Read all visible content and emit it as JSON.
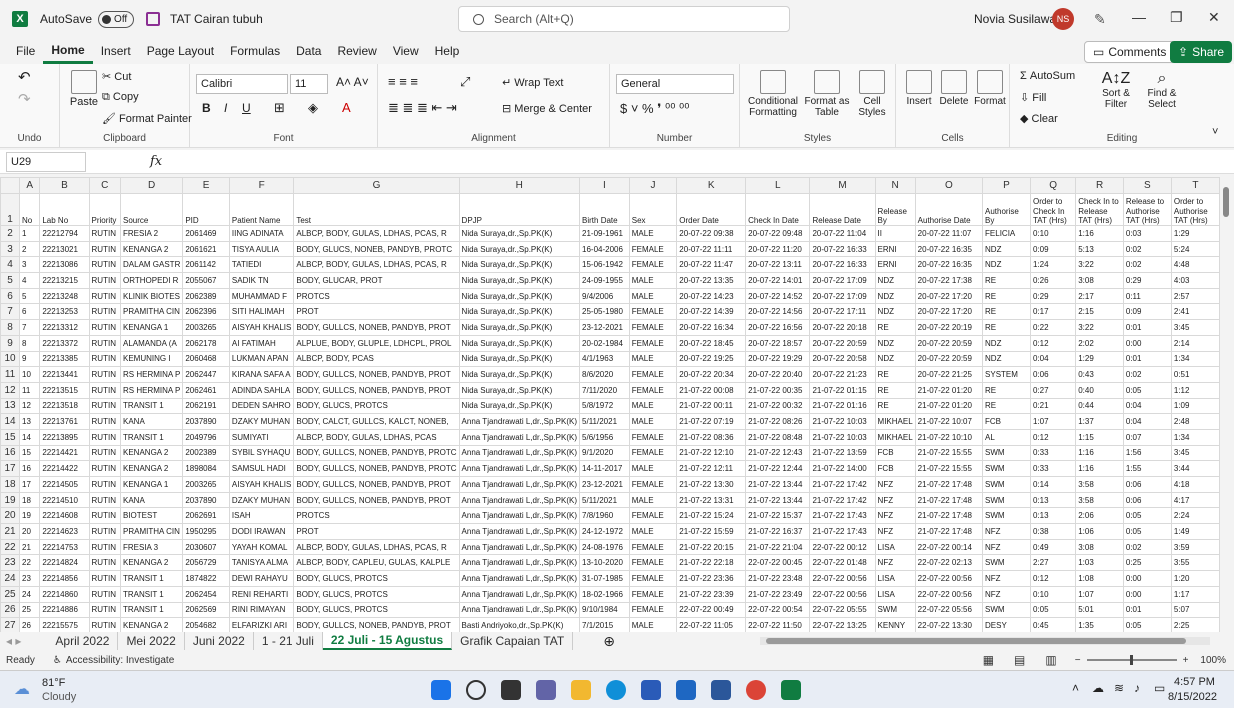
{
  "titlebar": {
    "app_logo": "X",
    "autosave_label": "AutoSave",
    "autosave_state": "Off",
    "doc_title": "TAT Cairan tubuh",
    "search_placeholder": "Search (Alt+Q)",
    "user_name": "Novia Susilawati",
    "user_initials": "NS"
  },
  "menu": {
    "tabs": [
      "File",
      "Home",
      "Insert",
      "Page Layout",
      "Formulas",
      "Data",
      "Review",
      "View",
      "Help"
    ],
    "active": "Home",
    "comments": "Comments",
    "share": "Share"
  },
  "ribbon": {
    "undo_group": "Undo",
    "clipboard": {
      "label": "Clipboard",
      "paste": "Paste",
      "cut": "Cut",
      "copy": "Copy",
      "format_painter": "Format Painter"
    },
    "font": {
      "label": "Font",
      "name": "Calibri",
      "size": "11"
    },
    "alignment": {
      "label": "Alignment",
      "wrap": "Wrap Text",
      "merge": "Merge & Center"
    },
    "number": {
      "label": "Number",
      "format": "General"
    },
    "styles": {
      "label": "Styles",
      "conditional": "Conditional Formatting",
      "format_table": "Format as Table",
      "cell_styles": "Cell Styles"
    },
    "cells": {
      "label": "Cells",
      "insert": "Insert",
      "delete": "Delete",
      "format": "Format"
    },
    "editing": {
      "label": "Editing",
      "autosum": "AutoSum",
      "fill": "Fill",
      "clear": "Clear",
      "sort": "Sort & Filter",
      "find": "Find & Select"
    }
  },
  "formula": {
    "namebox": "U29",
    "fx": "fx"
  },
  "columns": [
    "A",
    "B",
    "C",
    "D",
    "E",
    "F",
    "G",
    "H",
    "I",
    "J",
    "K",
    "L",
    "M",
    "N",
    "O",
    "P",
    "Q",
    "R",
    "S",
    "T"
  ],
  "headers": [
    "No",
    "Lab No",
    "Priority",
    "Source",
    "PID",
    "Patient Name",
    "Test",
    "DPJP",
    "Birth Date",
    "Sex",
    "Order Date",
    "Check In Date",
    "Release Date",
    "Release By",
    "Authorise Date",
    "Authorise By",
    "Order to Check In TAT (Hrs)",
    "Check In to Release TAT (Hrs)",
    "Release to Authorise TAT (Hrs)",
    "Order to Authorise TAT (Hrs)"
  ],
  "rows": [
    [
      "1",
      "22212794",
      "RUTIN",
      "FRESIA 2",
      "2061469",
      "IING ADINATA",
      "ALBCP, BODY, GULAS, LDHAS, PCAS, R",
      "Nida Suraya,dr.,Sp.PK(K)",
      "21-09-1961",
      "MALE",
      "20-07-22 09:38",
      "20-07-22 09:48",
      "20-07-22 11:04",
      "II",
      "20-07-22 11:07",
      "FELICIA",
      "0:10",
      "1:16",
      "0:03",
      "1:29"
    ],
    [
      "2",
      "22213021",
      "RUTIN",
      "KENANGA 2",
      "2061621",
      "TISYA AULIA",
      "BODY, GLUCS, NONEB, PANDYB, PROTC",
      "Nida Suraya,dr.,Sp.PK(K)",
      "16-04-2006",
      "FEMALE",
      "20-07-22 11:11",
      "20-07-22 11:20",
      "20-07-22 16:33",
      "ERNI",
      "20-07-22 16:35",
      "NDZ",
      "0:09",
      "5:13",
      "0:02",
      "5:24"
    ],
    [
      "3",
      "22213086",
      "RUTIN",
      "DALAM GASTR",
      "2061142",
      "TATIEDI",
      "ALBCP, BODY, GULAS, LDHAS, PCAS, R",
      "Nida Suraya,dr.,Sp.PK(K)",
      "15-06-1942",
      "FEMALE",
      "20-07-22 11:47",
      "20-07-22 13:11",
      "20-07-22 16:33",
      "ERNI",
      "20-07-22 16:35",
      "NDZ",
      "1:24",
      "3:22",
      "0:02",
      "4:48"
    ],
    [
      "4",
      "22213215",
      "RUTIN",
      "ORTHOPEDI R",
      "2055067",
      "SADIK TN",
      "BODY, GLUCAR, PROT",
      "Nida Suraya,dr.,Sp.PK(K)",
      "24-09-1955",
      "MALE",
      "20-07-22 13:35",
      "20-07-22 14:01",
      "20-07-22 17:09",
      "NDZ",
      "20-07-22 17:38",
      "RE",
      "0:26",
      "3:08",
      "0:29",
      "4:03"
    ],
    [
      "5",
      "22213248",
      "RUTIN",
      "KLINIK BIOTES",
      "2062389",
      "MUHAMMAD F",
      "PROTCS",
      "Nida Suraya,dr.,Sp.PK(K)",
      "9/4/2006",
      "MALE",
      "20-07-22 14:23",
      "20-07-22 14:52",
      "20-07-22 17:09",
      "NDZ",
      "20-07-22 17:20",
      "RE",
      "0:29",
      "2:17",
      "0:11",
      "2:57"
    ],
    [
      "6",
      "22213253",
      "RUTIN",
      "PRAMITHA CIN",
      "2062396",
      "SITI HALIMAH",
      "PROT",
      "Nida Suraya,dr.,Sp.PK(K)",
      "25-05-1980",
      "FEMALE",
      "20-07-22 14:39",
      "20-07-22 14:56",
      "20-07-22 17:11",
      "NDZ",
      "20-07-22 17:20",
      "RE",
      "0:17",
      "2:15",
      "0:09",
      "2:41"
    ],
    [
      "7",
      "22213312",
      "RUTIN",
      "KENANGA 1",
      "2003265",
      "AISYAH KHALIS",
      "BODY, GULLCS, NONEB, PANDYB, PROT",
      "Nida Suraya,dr.,Sp.PK(K)",
      "23-12-2021",
      "FEMALE",
      "20-07-22 16:34",
      "20-07-22 16:56",
      "20-07-22 20:18",
      "RE",
      "20-07-22 20:19",
      "RE",
      "0:22",
      "3:22",
      "0:01",
      "3:45"
    ],
    [
      "8",
      "22213372",
      "RUTIN",
      "ALAMANDA (A",
      "2062178",
      "AI FATIMAH",
      "ALPLUE, BODY, GLUPLE, LDHCPL, PROL",
      "Nida Suraya,dr.,Sp.PK(K)",
      "20-02-1984",
      "FEMALE",
      "20-07-22 18:45",
      "20-07-22 18:57",
      "20-07-22 20:59",
      "NDZ",
      "20-07-22 20:59",
      "NDZ",
      "0:12",
      "2:02",
      "0:00",
      "2:14"
    ],
    [
      "9",
      "22213385",
      "RUTIN",
      "KEMUNING I",
      "2060468",
      "LUKMAN APAN",
      "ALBCP, BODY, PCAS",
      "Nida Suraya,dr.,Sp.PK(K)",
      "4/1/1963",
      "MALE",
      "20-07-22 19:25",
      "20-07-22 19:29",
      "20-07-22 20:58",
      "NDZ",
      "20-07-22 20:59",
      "NDZ",
      "0:04",
      "1:29",
      "0:01",
      "1:34"
    ],
    [
      "10",
      "22213441",
      "RUTIN",
      "RS HERMINA P",
      "2062447",
      "KIRANA SAFA A",
      "BODY, GULLCS, NONEB, PANDYB, PROT",
      "Nida Suraya,dr.,Sp.PK(K)",
      "8/6/2020",
      "FEMALE",
      "20-07-22 20:34",
      "20-07-22 20:40",
      "20-07-22 21:23",
      "RE",
      "20-07-22 21:25",
      "SYSTEM",
      "0:06",
      "0:43",
      "0:02",
      "0:51"
    ],
    [
      "11",
      "22213515",
      "RUTIN",
      "RS HERMINA P",
      "2062461",
      "ADINDA SAHLA",
      "BODY, GULLCS, NONEB, PANDYB, PROT",
      "Nida Suraya,dr.,Sp.PK(K)",
      "7/11/2020",
      "FEMALE",
      "21-07-22 00:08",
      "21-07-22 00:35",
      "21-07-22 01:15",
      "RE",
      "21-07-22 01:20",
      "RE",
      "0:27",
      "0:40",
      "0:05",
      "1:12"
    ],
    [
      "12",
      "22213518",
      "RUTIN",
      "TRANSIT 1",
      "2062191",
      "DEDEN SAHRO",
      "BODY, GLUCS, PROTCS",
      "Nida Suraya,dr.,Sp.PK(K)",
      "5/8/1972",
      "MALE",
      "21-07-22 00:11",
      "21-07-22 00:32",
      "21-07-22 01:16",
      "RE",
      "21-07-22 01:20",
      "RE",
      "0:21",
      "0:44",
      "0:04",
      "1:09"
    ],
    [
      "13",
      "22213761",
      "RUTIN",
      "KANA",
      "2037890",
      "DZAKY MUHAN",
      "BODY, CALCT, GULLCS, KALCT, NONEB,",
      "Anna Tjandrawati L,dr.,Sp.PK(K)",
      "5/11/2021",
      "MALE",
      "21-07-22 07:19",
      "21-07-22 08:26",
      "21-07-22 10:03",
      "MIKHAEL",
      "21-07-22 10:07",
      "FCB",
      "1:07",
      "1:37",
      "0:04",
      "2:48"
    ],
    [
      "14",
      "22213895",
      "RUTIN",
      "TRANSIT 1",
      "2049796",
      "SUMIYATI",
      "ALBCP, BODY, GULAS, LDHAS, PCAS",
      "Anna Tjandrawati L,dr.,Sp.PK(K)",
      "5/6/1956",
      "FEMALE",
      "21-07-22 08:36",
      "21-07-22 08:48",
      "21-07-22 10:03",
      "MIKHAEL",
      "21-07-22 10:10",
      "AL",
      "0:12",
      "1:15",
      "0:07",
      "1:34"
    ],
    [
      "15",
      "22214421",
      "RUTIN",
      "KENANGA 2",
      "2002389",
      "SYBIL SYHAQU",
      "BODY, GULLCS, NONEB, PANDYB, PROTC",
      "Anna Tjandrawati L,dr.,Sp.PK(K)",
      "9/1/2020",
      "FEMALE",
      "21-07-22 12:10",
      "21-07-22 12:43",
      "21-07-22 13:59",
      "FCB",
      "21-07-22 15:55",
      "SWM",
      "0:33",
      "1:16",
      "1:56",
      "3:45"
    ],
    [
      "16",
      "22214422",
      "RUTIN",
      "KENANGA 2",
      "1898084",
      "SAMSUL HADI",
      "BODY, GULLCS, NONEB, PANDYB, PROTC",
      "Anna Tjandrawati L,dr.,Sp.PK(K)",
      "14-11-2017",
      "MALE",
      "21-07-22 12:11",
      "21-07-22 12:44",
      "21-07-22 14:00",
      "FCB",
      "21-07-22 15:55",
      "SWM",
      "0:33",
      "1:16",
      "1:55",
      "3:44"
    ],
    [
      "17",
      "22214505",
      "RUTIN",
      "KENANGA 1",
      "2003265",
      "AISYAH KHALIS",
      "BODY, GULLCS, NONEB, PANDYB, PROT",
      "Anna Tjandrawati L,dr.,Sp.PK(K)",
      "23-12-2021",
      "FEMALE",
      "21-07-22 13:30",
      "21-07-22 13:44",
      "21-07-22 17:42",
      "NFZ",
      "21-07-22 17:48",
      "SWM",
      "0:14",
      "3:58",
      "0:06",
      "4:18"
    ],
    [
      "18",
      "22214510",
      "RUTIN",
      "KANA",
      "2037890",
      "DZAKY MUHAN",
      "BODY, GULLCS, NONEB, PANDYB, PROT",
      "Anna Tjandrawati L,dr.,Sp.PK(K)",
      "5/11/2021",
      "MALE",
      "21-07-22 13:31",
      "21-07-22 13:44",
      "21-07-22 17:42",
      "NFZ",
      "21-07-22 17:48",
      "SWM",
      "0:13",
      "3:58",
      "0:06",
      "4:17"
    ],
    [
      "19",
      "22214608",
      "RUTIN",
      "BIOTEST",
      "2062691",
      "ISAH",
      "PROTCS",
      "Anna Tjandrawati L,dr.,Sp.PK(K)",
      "7/8/1960",
      "FEMALE",
      "21-07-22 15:24",
      "21-07-22 15:37",
      "21-07-22 17:43",
      "NFZ",
      "21-07-22 17:48",
      "SWM",
      "0:13",
      "2:06",
      "0:05",
      "2:24"
    ],
    [
      "20",
      "22214623",
      "RUTIN",
      "PRAMITHA CIN",
      "1950295",
      "DODI IRAWAN",
      "PROT",
      "Anna Tjandrawati L,dr.,Sp.PK(K)",
      "24-12-1972",
      "MALE",
      "21-07-22 15:59",
      "21-07-22 16:37",
      "21-07-22 17:43",
      "NFZ",
      "21-07-22 17:48",
      "NFZ",
      "0:38",
      "1:06",
      "0:05",
      "1:49"
    ],
    [
      "21",
      "22214753",
      "RUTIN",
      "FRESIA 3",
      "2030607",
      "YAYAH KOMAL",
      "ALBCP, BODY, GULAS, LDHAS, PCAS, R",
      "Anna Tjandrawati L,dr.,Sp.PK(K)",
      "24-08-1976",
      "FEMALE",
      "21-07-22 20:15",
      "21-07-22 21:04",
      "22-07-22 00:12",
      "LISA",
      "22-07-22 00:14",
      "NFZ",
      "0:49",
      "3:08",
      "0:02",
      "3:59"
    ],
    [
      "22",
      "22214824",
      "RUTIN",
      "KENANGA 2",
      "2056729",
      "TANISYA ALMA",
      "ALBCP, BODY, CAPLEU, GULAS, KALPLE",
      "Anna Tjandrawati L,dr.,Sp.PK(K)",
      "13-10-2020",
      "FEMALE",
      "21-07-22 22:18",
      "22-07-22 00:45",
      "22-07-22 01:48",
      "NFZ",
      "22-07-22 02:13",
      "SWM",
      "2:27",
      "1:03",
      "0:25",
      "3:55"
    ],
    [
      "23",
      "22214856",
      "RUTIN",
      "TRANSIT 1",
      "1874822",
      "DEWI RAHAYU",
      "BODY, GLUCS, PROTCS",
      "Anna Tjandrawati L,dr.,Sp.PK(K)",
      "31-07-1985",
      "FEMALE",
      "21-07-22 23:36",
      "21-07-22 23:48",
      "22-07-22 00:56",
      "LISA",
      "22-07-22 00:56",
      "NFZ",
      "0:12",
      "1:08",
      "0:00",
      "1:20"
    ],
    [
      "24",
      "22214860",
      "RUTIN",
      "TRANSIT 1",
      "2062454",
      "RENI REHARTI",
      "BODY, GLUCS, PROTCS",
      "Anna Tjandrawati L,dr.,Sp.PK(K)",
      "18-02-1966",
      "FEMALE",
      "21-07-22 23:39",
      "21-07-22 23:49",
      "22-07-22 00:56",
      "LISA",
      "22-07-22 00:56",
      "NFZ",
      "0:10",
      "1:07",
      "0:00",
      "1:17"
    ],
    [
      "25",
      "22214886",
      "RUTIN",
      "TRANSIT 1",
      "2062569",
      "RINI RIMAYAN",
      "BODY, GLUCS, PROTCS",
      "Anna Tjandrawati L,dr.,Sp.PK(K)",
      "9/10/1984",
      "FEMALE",
      "22-07-22 00:49",
      "22-07-22 00:54",
      "22-07-22 05:55",
      "SWM",
      "22-07-22 05:56",
      "SWM",
      "0:05",
      "5:01",
      "0:01",
      "5:07"
    ],
    [
      "26",
      "22215575",
      "RUTIN",
      "KENANGA 2",
      "2054682",
      "ELFARIZKI ARI",
      "BODY, GULLCS, NONEB, PANDYB, PROT",
      "Basti Andriyoko,dr.,Sp.PK(K)",
      "7/1/2015",
      "MALE",
      "22-07-22 11:05",
      "22-07-22 11:50",
      "22-07-22 13:25",
      "KENNY",
      "22-07-22 13:30",
      "DESY",
      "0:45",
      "1:35",
      "0:05",
      "2:25"
    ]
  ],
  "sheet_tabs": [
    "April 2022",
    "Mei 2022",
    "Juni 2022",
    "1 - 21 Juli",
    "22 Juli - 15 Agustus",
    "Grafik Capaian TAT"
  ],
  "active_sheet": "22 Juli - 15 Agustus",
  "status": {
    "ready": "Ready",
    "accessibility": "Accessibility: Investigate",
    "zoom": "100%"
  },
  "taskbar": {
    "temp": "81°F",
    "weather": "Cloudy",
    "time": "4:57 PM",
    "date": "8/15/2022"
  }
}
